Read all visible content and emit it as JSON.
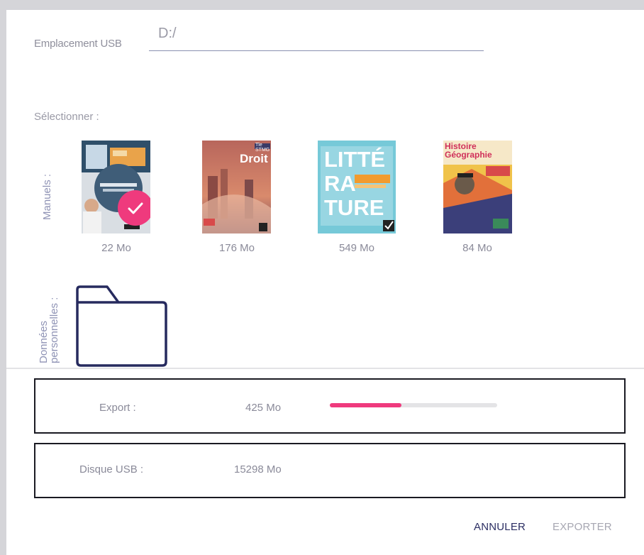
{
  "usb": {
    "label": "Emplacement USB",
    "value": "D:/"
  },
  "selection": {
    "label": "Sélectionner :",
    "manuels_label": "Manuels :",
    "books": [
      {
        "size": "22 Mo",
        "selected": true,
        "cover_text": ""
      },
      {
        "size": "176 Mo",
        "selected": false,
        "cover_text": "Droit",
        "badge": "Tle STMG"
      },
      {
        "size": "549 Mo",
        "selected": false,
        "cover_text": "LITTÉ RA TURE"
      },
      {
        "size": "84 Mo",
        "selected": false,
        "cover_text": "Histoire Géographie"
      }
    ],
    "donnees_label_line1": "Données",
    "donnees_label_line2": "personnelles :"
  },
  "export_box": {
    "label": "Export :",
    "value": "425 Mo",
    "progress": 0.43
  },
  "disk_box": {
    "label": "Disque USB :",
    "value": "15298 Mo"
  },
  "actions": {
    "cancel": "ANNULER",
    "export": "EXPORTER"
  },
  "colors": {
    "accent": "#ef3a7d",
    "navy": "#2b2e63",
    "frame": "#d5d5d9"
  }
}
